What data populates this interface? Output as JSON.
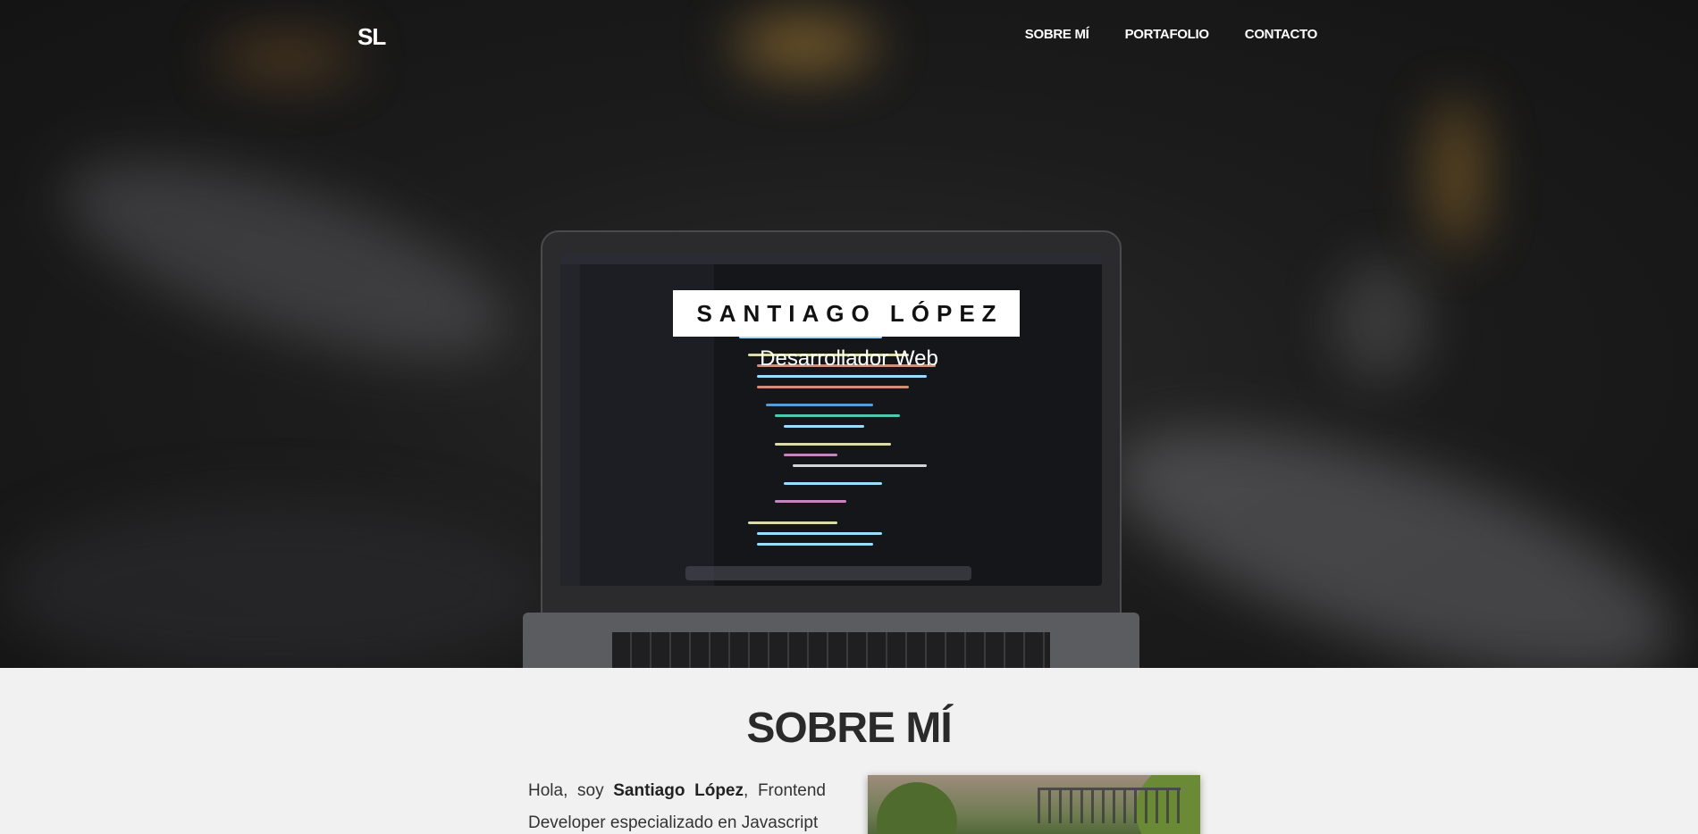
{
  "nav": {
    "logo": "SL",
    "items": [
      {
        "label": "SOBRE MÍ"
      },
      {
        "label": "PORTAFOLIO"
      },
      {
        "label": "CONTACTO"
      }
    ]
  },
  "hero": {
    "title": "SANTIAGO LÓPEZ",
    "subtitle": "Desarrollador Web"
  },
  "about": {
    "heading": "SOBRE MÍ",
    "intro_prefix": "Hola, soy ",
    "intro_name": "Santiago López",
    "intro_suffix": ", Frontend Developer especializado en Javascript"
  },
  "colors": {
    "hero_overlay": "#1c1c1c",
    "title_box": "#ffffff",
    "section_bg": "#f1f1f1",
    "heading": "#2a2a2a"
  }
}
